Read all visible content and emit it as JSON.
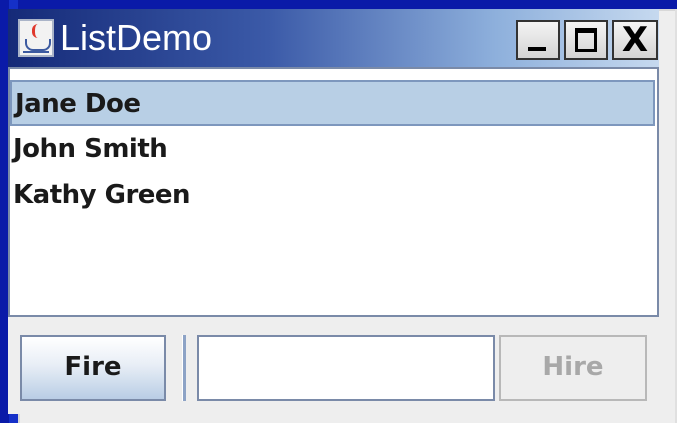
{
  "window": {
    "title": "ListDemo",
    "icon": "java-cup-icon",
    "controls": {
      "minimize_icon": "minimize-icon",
      "maximize_icon": "maximize-icon",
      "close_label": "X"
    }
  },
  "list": {
    "items": [
      {
        "label": "Jane Doe",
        "selected": true
      },
      {
        "label": "John Smith",
        "selected": false
      },
      {
        "label": "Kathy Green",
        "selected": false
      }
    ]
  },
  "bottom": {
    "fire_label": "Fire",
    "name_field_value": "",
    "hire_label": "Hire",
    "hire_enabled": false
  },
  "colors": {
    "selection_background": "#b8cfe5",
    "titlebar_start": "#152a78",
    "titlebar_end": "#c6d9ef",
    "disabled_text": "#a8a8a8"
  }
}
